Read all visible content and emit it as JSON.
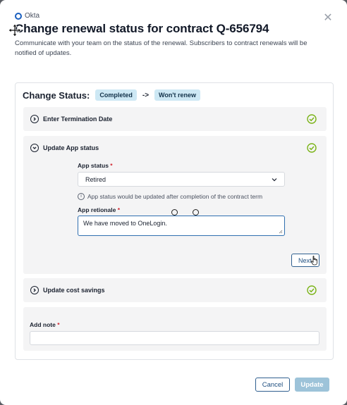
{
  "app": {
    "name": "Okta"
  },
  "dialog": {
    "title": "Change renewal status for contract Q-656794",
    "subtitle": "Communicate with your team on the status of the renewal. Subscribers to contract renewals will be notified of updates.",
    "close_icon": "close-icon"
  },
  "status": {
    "label": "Change Status:",
    "from": "Completed",
    "arrow": "->",
    "to": "Won't renew"
  },
  "sections": {
    "termination": {
      "label": "Enter Termination Date",
      "icon": "chevron-right-circle-icon",
      "complete": true
    },
    "app_status": {
      "label": "Update App status",
      "icon": "chevron-down-circle-icon",
      "complete": true,
      "status_field_label": "App status",
      "status_value": "Retired",
      "info_text": "App status would be updated after completion of the contract term",
      "rationale_label": "App retionale",
      "rationale_value": "We have moved to OneLogin.",
      "next_label": "Next"
    },
    "cost_savings": {
      "label": "Update cost savings",
      "icon": "chevron-right-circle-icon",
      "complete": true
    },
    "note": {
      "label": "Add note",
      "value": ""
    }
  },
  "required_marker": "*",
  "footer": {
    "cancel_label": "Cancel",
    "update_label": "Update"
  },
  "colors": {
    "accent": "#2f5f8f",
    "success": "#7ab317",
    "badge_bg": "#cde8f4",
    "required": "#d1242f"
  }
}
